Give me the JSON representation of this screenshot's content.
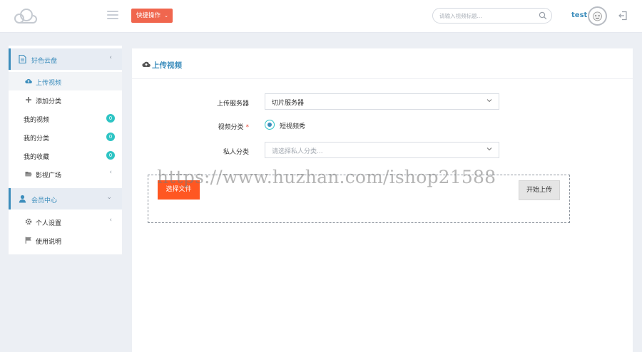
{
  "header": {
    "quick_action_label": "快捷操作",
    "search_placeholder": "请输入视频标题...",
    "username": "test"
  },
  "sidebar": {
    "group_cloud": "好色云盘",
    "items": [
      {
        "label": "上传视频",
        "icon": "cloud-upload-icon",
        "active": true
      },
      {
        "label": "添加分类",
        "icon": "plus-icon"
      },
      {
        "label": "我的视频",
        "badge": "0"
      },
      {
        "label": "我的分类",
        "badge": "0"
      },
      {
        "label": "我的收藏",
        "badge": "0"
      },
      {
        "label": "影视广场",
        "icon": "folder-open-icon"
      }
    ],
    "group_member": "会员中心",
    "member_items": [
      {
        "label": "个人设置",
        "icon": "gear-icon"
      },
      {
        "label": "使用说明",
        "icon": "flag-icon"
      }
    ]
  },
  "panel": {
    "title": "上传视频",
    "server_label": "上传服务器",
    "server_value": "切片服务器",
    "category_label": "视频分类",
    "category_option": "短视频秀",
    "private_label": "私人分类",
    "private_placeholder": "请选择私人分类...",
    "choose_file_label": "选择文件",
    "start_upload_label": "开始上传"
  },
  "watermark": "https://www.huzhan.com/ishop21588",
  "colors": {
    "accent": "#3c8dbc",
    "quick_button": "#f0664e",
    "choose_button": "#ff5722",
    "badge": "#2ec4c4"
  }
}
